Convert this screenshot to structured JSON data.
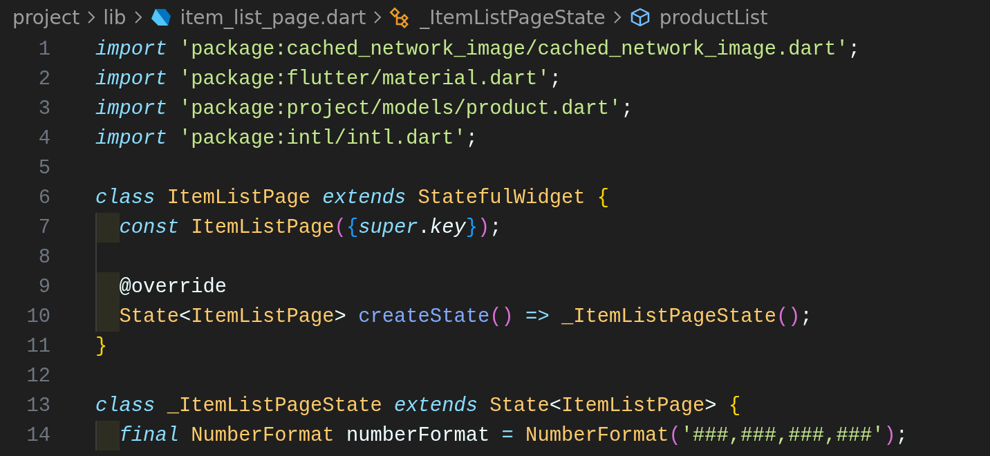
{
  "breadcrumb": [
    {
      "label": "project",
      "kind": "folder"
    },
    {
      "label": "lib",
      "kind": "folder"
    },
    {
      "label": "item_list_page.dart",
      "kind": "file"
    },
    {
      "label": "_ItemListPageState",
      "kind": "class"
    },
    {
      "label": "productList",
      "kind": "field"
    }
  ],
  "lines": [
    {
      "number": "1",
      "indented": false,
      "indent_shaded": false,
      "tokens": [
        {
          "text": "import ",
          "kind": "keyword"
        },
        {
          "text": "'package:cached_network_image/cached_network_image.dart'",
          "kind": "string"
        },
        {
          "text": ";",
          "kind": "plain"
        }
      ]
    },
    {
      "number": "2",
      "indented": false,
      "indent_shaded": false,
      "tokens": [
        {
          "text": "import ",
          "kind": "keyword"
        },
        {
          "text": "'package:flutter/material.dart'",
          "kind": "string"
        },
        {
          "text": ";",
          "kind": "plain"
        }
      ]
    },
    {
      "number": "3",
      "indented": false,
      "indent_shaded": false,
      "tokens": [
        {
          "text": "import ",
          "kind": "keyword"
        },
        {
          "text": "'package:project/models/product.dart'",
          "kind": "string"
        },
        {
          "text": ";",
          "kind": "plain"
        }
      ]
    },
    {
      "number": "4",
      "indented": false,
      "indent_shaded": false,
      "tokens": [
        {
          "text": "import ",
          "kind": "keyword"
        },
        {
          "text": "'package:intl/intl.dart'",
          "kind": "string"
        },
        {
          "text": ";",
          "kind": "plain"
        }
      ]
    },
    {
      "number": "5",
      "indented": false,
      "indent_shaded": false
    },
    {
      "number": "6",
      "indented": false,
      "indent_shaded": false,
      "tokens": [
        {
          "text": "class ",
          "kind": "keyword"
        },
        {
          "text": "ItemListPage ",
          "kind": "type"
        },
        {
          "text": "extends ",
          "kind": "keyword"
        },
        {
          "text": "StatefulWidget ",
          "kind": "type"
        },
        {
          "text": "{",
          "kind": "bracket1"
        }
      ]
    },
    {
      "number": "7",
      "indented": true,
      "indent_shaded": true,
      "tokens": [
        {
          "text": "const ",
          "kind": "keyword"
        },
        {
          "text": "ItemListPage",
          "kind": "type"
        },
        {
          "text": "(",
          "kind": "bracket2"
        },
        {
          "text": "{",
          "kind": "bracket3"
        },
        {
          "text": "super",
          "kind": "keyword"
        },
        {
          "text": ".",
          "kind": "plain"
        },
        {
          "text": "key",
          "kind": "param"
        },
        {
          "text": "}",
          "kind": "bracket3"
        },
        {
          "text": ")",
          "kind": "bracket2"
        },
        {
          "text": ";",
          "kind": "plain"
        }
      ]
    },
    {
      "number": "8",
      "indented": true,
      "indent_shaded": false
    },
    {
      "number": "9",
      "indented": true,
      "indent_shaded": true,
      "tokens": [
        {
          "text": "@override",
          "kind": "plain"
        }
      ]
    },
    {
      "number": "10",
      "indented": true,
      "indent_shaded": true,
      "tokens": [
        {
          "text": "State",
          "kind": "type"
        },
        {
          "text": "<",
          "kind": "plain"
        },
        {
          "text": "ItemListPage",
          "kind": "type"
        },
        {
          "text": "> ",
          "kind": "plain"
        },
        {
          "text": "createState",
          "kind": "func"
        },
        {
          "text": "() ",
          "kind": "bracket2"
        },
        {
          "text": "=> ",
          "kind": "operator"
        },
        {
          "text": "_ItemListPageState",
          "kind": "type"
        },
        {
          "text": "()",
          "kind": "bracket2"
        },
        {
          "text": ";",
          "kind": "plain"
        }
      ]
    },
    {
      "number": "11",
      "indented": false,
      "indent_shaded": false,
      "tokens": [
        {
          "text": "}",
          "kind": "bracket1"
        }
      ]
    },
    {
      "number": "12",
      "indented": false,
      "indent_shaded": false
    },
    {
      "number": "13",
      "indented": false,
      "indent_shaded": false,
      "tokens": [
        {
          "text": "class ",
          "kind": "keyword"
        },
        {
          "text": "_ItemListPageState ",
          "kind": "type"
        },
        {
          "text": "extends ",
          "kind": "keyword"
        },
        {
          "text": "State",
          "kind": "type"
        },
        {
          "text": "<",
          "kind": "plain"
        },
        {
          "text": "ItemListPage",
          "kind": "type"
        },
        {
          "text": "> ",
          "kind": "plain"
        },
        {
          "text": "{",
          "kind": "bracket1"
        }
      ]
    },
    {
      "number": "14",
      "indented": true,
      "indent_shaded": true,
      "tokens": [
        {
          "text": "final ",
          "kind": "keyword"
        },
        {
          "text": "NumberFormat ",
          "kind": "type"
        },
        {
          "text": "numberFormat ",
          "kind": "plain"
        },
        {
          "text": "= ",
          "kind": "operator"
        },
        {
          "text": "NumberFormat",
          "kind": "type"
        },
        {
          "text": "(",
          "kind": "bracket2"
        },
        {
          "text": "'###,###,###,###'",
          "kind": "string"
        },
        {
          "text": ")",
          "kind": "bracket2"
        },
        {
          "text": ";",
          "kind": "plain"
        }
      ]
    }
  ]
}
